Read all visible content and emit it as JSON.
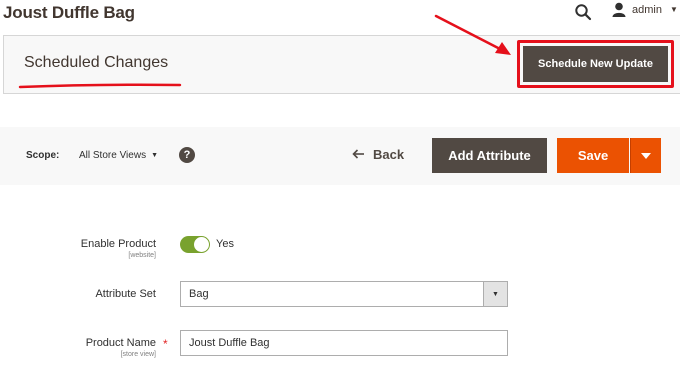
{
  "page": {
    "title": "Joust Duffle Bag"
  },
  "header": {
    "user_name": "admin",
    "icons": {
      "search": "search-icon",
      "user": "user-icon",
      "caret": "chevron-down-icon"
    }
  },
  "staging": {
    "title": "Scheduled Changes",
    "schedule_button_label": "Schedule New Update",
    "annotation_color": "#e5101b"
  },
  "toolbar": {
    "scope_label": "Scope:",
    "scope_value": "All Store Views",
    "help_icon": "?",
    "back_label": "Back",
    "add_attribute_label": "Add Attribute",
    "save_label": "Save"
  },
  "form": {
    "enable_product": {
      "label": "Enable Product",
      "scope": "[website]",
      "value_text": "Yes",
      "enabled": true
    },
    "attribute_set": {
      "label": "Attribute Set",
      "value": "Bag"
    },
    "product_name": {
      "label": "Product Name",
      "scope": "[store view]",
      "required_mark": "*",
      "value": "Joust Duffle Bag"
    }
  },
  "colors": {
    "primary_dark": "#514943",
    "save_orange": "#eb5202",
    "toggle_green": "#79a22e"
  }
}
